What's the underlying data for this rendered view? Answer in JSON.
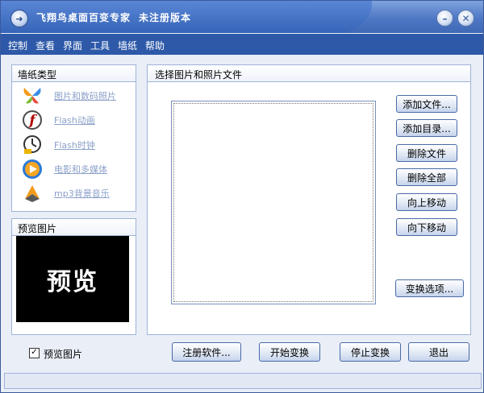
{
  "titlebar": {
    "title": "飞翔鸟桌面百变专家",
    "reg_status": "未注册版本",
    "minimize": "–",
    "close": "✕"
  },
  "menu": [
    "控制",
    "查看",
    "界面",
    "工具",
    "墙纸",
    "帮助"
  ],
  "wallpaper_types": {
    "title": "墙纸类型",
    "items": [
      {
        "label": "图片和数码照片",
        "icon": "butterfly-icon"
      },
      {
        "label": "Flash动画",
        "icon": "flash-icon"
      },
      {
        "label": "Flash时钟",
        "icon": "clock-icon"
      },
      {
        "label": "电影和多媒体",
        "icon": "media-player-icon"
      },
      {
        "label": "mp3背景音乐",
        "icon": "music-icon"
      }
    ]
  },
  "preview": {
    "title": "预览图片",
    "text": "预览"
  },
  "file_panel": {
    "title": "选择图片和照片文件"
  },
  "side_buttons": {
    "add_file": "添加文件...",
    "add_dir": "添加目录...",
    "delete_file": "删除文件",
    "delete_all": "删除全部",
    "move_up": "向上移动",
    "move_down": "向下移动",
    "transition_options": "变换选项..."
  },
  "bottom": {
    "preview_checkbox": "预览图片",
    "preview_checked": true,
    "register": "注册软件...",
    "start": "开始变换",
    "stop": "停止变换",
    "exit": "退出"
  }
}
